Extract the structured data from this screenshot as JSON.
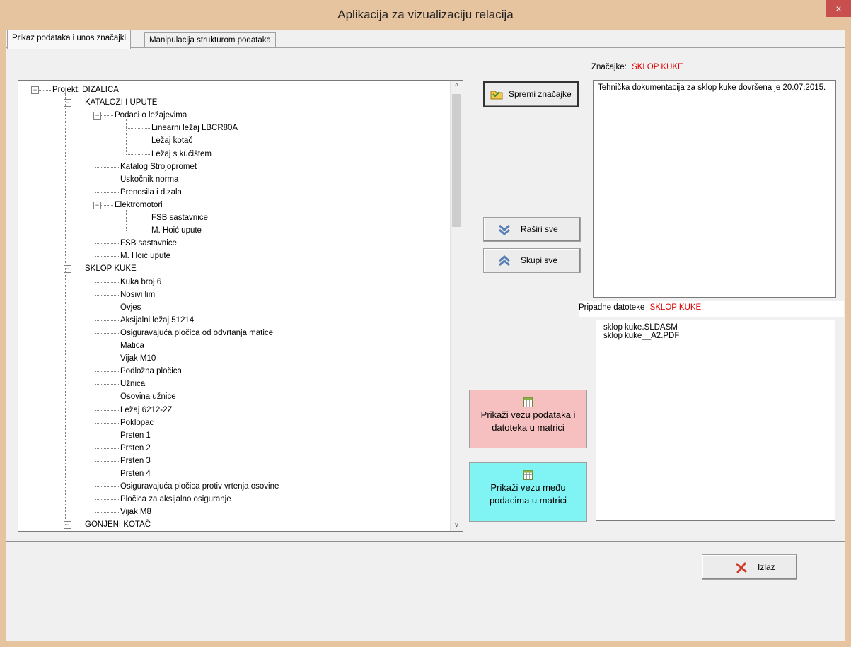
{
  "window": {
    "title": "Aplikacija za vizualizaciju relacija",
    "close_glyph": "×"
  },
  "tabs": [
    {
      "label": "Prikaz podataka i unos značajki",
      "active": true
    },
    {
      "label": "Manipulacija strukturom podataka",
      "active": false
    }
  ],
  "tree": {
    "nodes": [
      {
        "text": "Projekt: DIZALICA",
        "level": 0,
        "expanded": true
      },
      {
        "text": "KATALOZI I UPUTE",
        "level": 1,
        "expanded": true
      },
      {
        "text": "Podaci o ležajevima",
        "level": 2,
        "expanded": true
      },
      {
        "text": "Linearni ležaj LBCR80A",
        "level": 3
      },
      {
        "text": "Ležaj kotač",
        "level": 3
      },
      {
        "text": "Ležaj s kućištem",
        "level": 3
      },
      {
        "text": "Katalog Strojopromet",
        "level": 2
      },
      {
        "text": "Uskočnik norma",
        "level": 2
      },
      {
        "text": "Prenosila i dizala",
        "level": 2
      },
      {
        "text": "Elektromotori",
        "level": 2,
        "expanded": true
      },
      {
        "text": "FSB sastavnice",
        "level": 3
      },
      {
        "text": "M. Hoić upute",
        "level": 3
      },
      {
        "text": "FSB sastavnice",
        "level": 2
      },
      {
        "text": "M. Hoić upute",
        "level": 2
      },
      {
        "text": "SKLOP KUKE",
        "level": 1,
        "expanded": true
      },
      {
        "text": "Kuka broj 6",
        "level": 2
      },
      {
        "text": "Nosivi lim",
        "level": 2
      },
      {
        "text": "Ovjes",
        "level": 2
      },
      {
        "text": "Aksijalni ležaj 51214",
        "level": 2
      },
      {
        "text": "Osiguravajuća pločica od odvrtanja matice",
        "level": 2
      },
      {
        "text": "Matica",
        "level": 2
      },
      {
        "text": "Vijak M10",
        "level": 2
      },
      {
        "text": "Podložna pločica",
        "level": 2
      },
      {
        "text": "Užnica",
        "level": 2
      },
      {
        "text": "Osovina užnice",
        "level": 2
      },
      {
        "text": "Ležaj 6212-2Z",
        "level": 2
      },
      {
        "text": "Poklopac",
        "level": 2
      },
      {
        "text": "Prsten 1",
        "level": 2
      },
      {
        "text": "Prsten 2",
        "level": 2
      },
      {
        "text": "Prsten 3",
        "level": 2
      },
      {
        "text": "Prsten 4",
        "level": 2
      },
      {
        "text": "Osiguravajuća pločica protiv vrtenja osovine",
        "level": 2
      },
      {
        "text": "Pločica za aksijalno osiguranje",
        "level": 2
      },
      {
        "text": "Vijak M8",
        "level": 2
      },
      {
        "text": "GONJENI KOTAČ",
        "level": 1,
        "expanded": true
      }
    ],
    "scroll_up_glyph": "^",
    "scroll_down_glyph": "v"
  },
  "buttons": {
    "save_features": "Spremi značajke",
    "expand_all": "Raširi sve",
    "collapse_all": "Skupi sve",
    "show_data_files_matrix": "Prikaži vezu podataka i datoteka u matrici",
    "show_data_relations_matrix": "Prikaži vezu među podacima u matrici",
    "exit": "Izlaz"
  },
  "features": {
    "label": "Značajke:",
    "selected": "SKLOP KUKE",
    "text": "Tehnička dokumentacija za sklop kuke dovršena je 20.07.2015."
  },
  "files": {
    "label": "Pripadne datoteke",
    "selected": "SKLOP KUKE",
    "items": [
      "sklop kuke.SLDASM",
      "sklop kuke__A2.PDF"
    ]
  },
  "colors": {
    "frame": "#e6c4a0",
    "close": "#c94f4f",
    "btn_pink": "#f7c0c0",
    "btn_cyan": "#80f4f4",
    "accent_red": "#e00000"
  }
}
